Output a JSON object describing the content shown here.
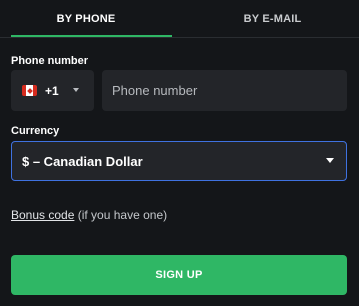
{
  "tabs": {
    "phone_label": "BY PHONE",
    "email_label": "BY E-MAIL",
    "active": "phone"
  },
  "phone": {
    "label": "Phone number",
    "country_flag": "canada-flag-icon",
    "dial_code": "+1",
    "input_value": "",
    "placeholder": "Phone number"
  },
  "currency": {
    "label": "Currency",
    "selected": "$ – Canadian Dollar"
  },
  "bonus": {
    "link_label": "Bonus code",
    "hint": " (if you have one)"
  },
  "signup": {
    "label": "SIGN UP"
  },
  "colors": {
    "background": "#141619",
    "field": "#232529",
    "accent_green": "#2fb765",
    "focus_blue": "#3f72e0"
  }
}
